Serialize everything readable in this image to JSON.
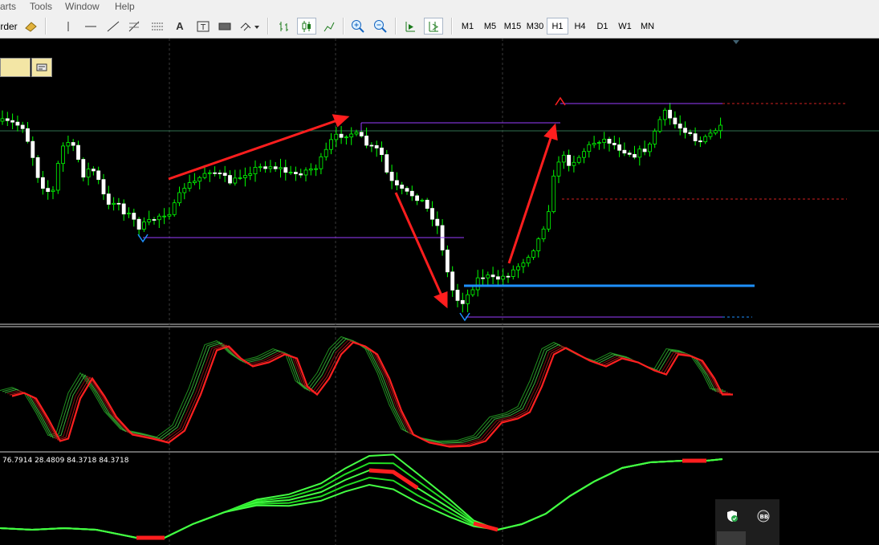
{
  "menu": {
    "charts": "arts",
    "tools": "Tools",
    "window": "Window",
    "help": "Help"
  },
  "toolbar": {
    "order_label": "rder",
    "timeframes": [
      "M1",
      "M5",
      "M15",
      "M30",
      "H1",
      "H4",
      "D1",
      "W1",
      "MN"
    ],
    "active_timeframe": "H1",
    "tool_icons": [
      "cursor-line-icon",
      "horizontal-line-icon",
      "trendline-icon",
      "fibo-icon",
      "grid-icon",
      "text-icon",
      "text-label-icon",
      "rectangle-icon",
      "arrows-icon",
      "bar-chart-icon",
      "candlestick-icon",
      "line-chart-icon",
      "zoom-in-icon",
      "zoom-out-icon",
      "autoscroll-icon",
      "chart-shift-icon"
    ]
  },
  "indicator": {
    "values": "76.7914 28.4809 84.3718 84.3718"
  },
  "colors": {
    "background": "#000000",
    "bull": "#00ff00",
    "arrow": "#ff1e1e",
    "level_blue": "#1e90ff",
    "level_purple": "#9a3cff",
    "stoch_red": "#ff2020",
    "stoch_green": "#2ecc40"
  }
}
